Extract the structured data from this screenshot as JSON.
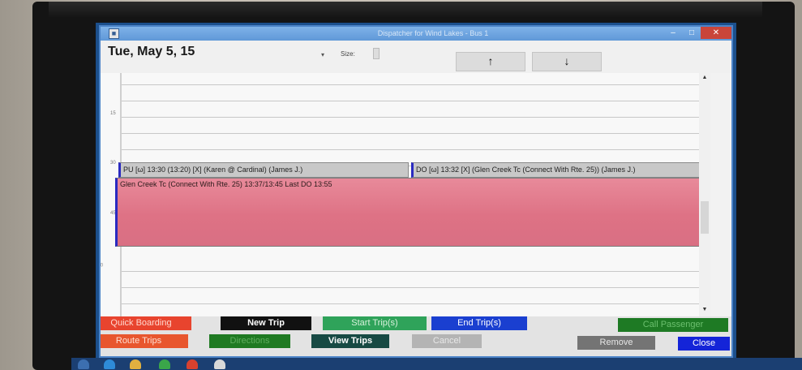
{
  "window": {
    "title": "Dispatcher for Wind Lakes - Bus 1",
    "minimize_label": "–",
    "maximize_label": "□",
    "close_label": "✕"
  },
  "toolbar": {
    "date": "Tue, May 5, 15",
    "date_caret": "▾",
    "size_label": "Size:",
    "up_label": "↑",
    "down_label": "↓"
  },
  "calendar": {
    "time_labels": [
      "15",
      "30",
      "45"
    ],
    "hour_label": "14",
    "hour_sup": "00"
  },
  "appointments": {
    "pickup": "PU [ω] 13:30 (13:20) [X]  (Karen @ Cardinal) (James J.)",
    "dropoff": "DO [ω] 13:32 [X]  (Glen Creek Tc (Connect With Rte. 25)) (James J.)",
    "trip": "Glen Creek Tc (Connect With Rte. 25) 13:37/13:45 Last DO 13:55"
  },
  "buttons": {
    "quick_boarding": "Quick Boarding",
    "new_trip": "New Trip",
    "start_trips": "Start Trip(s)",
    "end_trips": "End Trip(s)",
    "call_passenger": "Call Passenger",
    "route_trips": "Route Trips",
    "directions": "Directions",
    "view_trips": "View Trips",
    "cancel": "Cancel",
    "remove": "Remove",
    "close": "Close"
  },
  "colors": {
    "quick_boarding": "#e8442e",
    "new_trip": "#111111",
    "start_trips": "#2fa35a",
    "end_trips": "#1a3fd0",
    "call_passenger": "#1e7a24",
    "route_trips": "#e8562e",
    "directions": "#1f7a22",
    "view_trips": "#174a44",
    "cancel": "#b4b4b4",
    "remove": "#747474",
    "close": "#1424d8",
    "trip_block": "#de7285"
  }
}
